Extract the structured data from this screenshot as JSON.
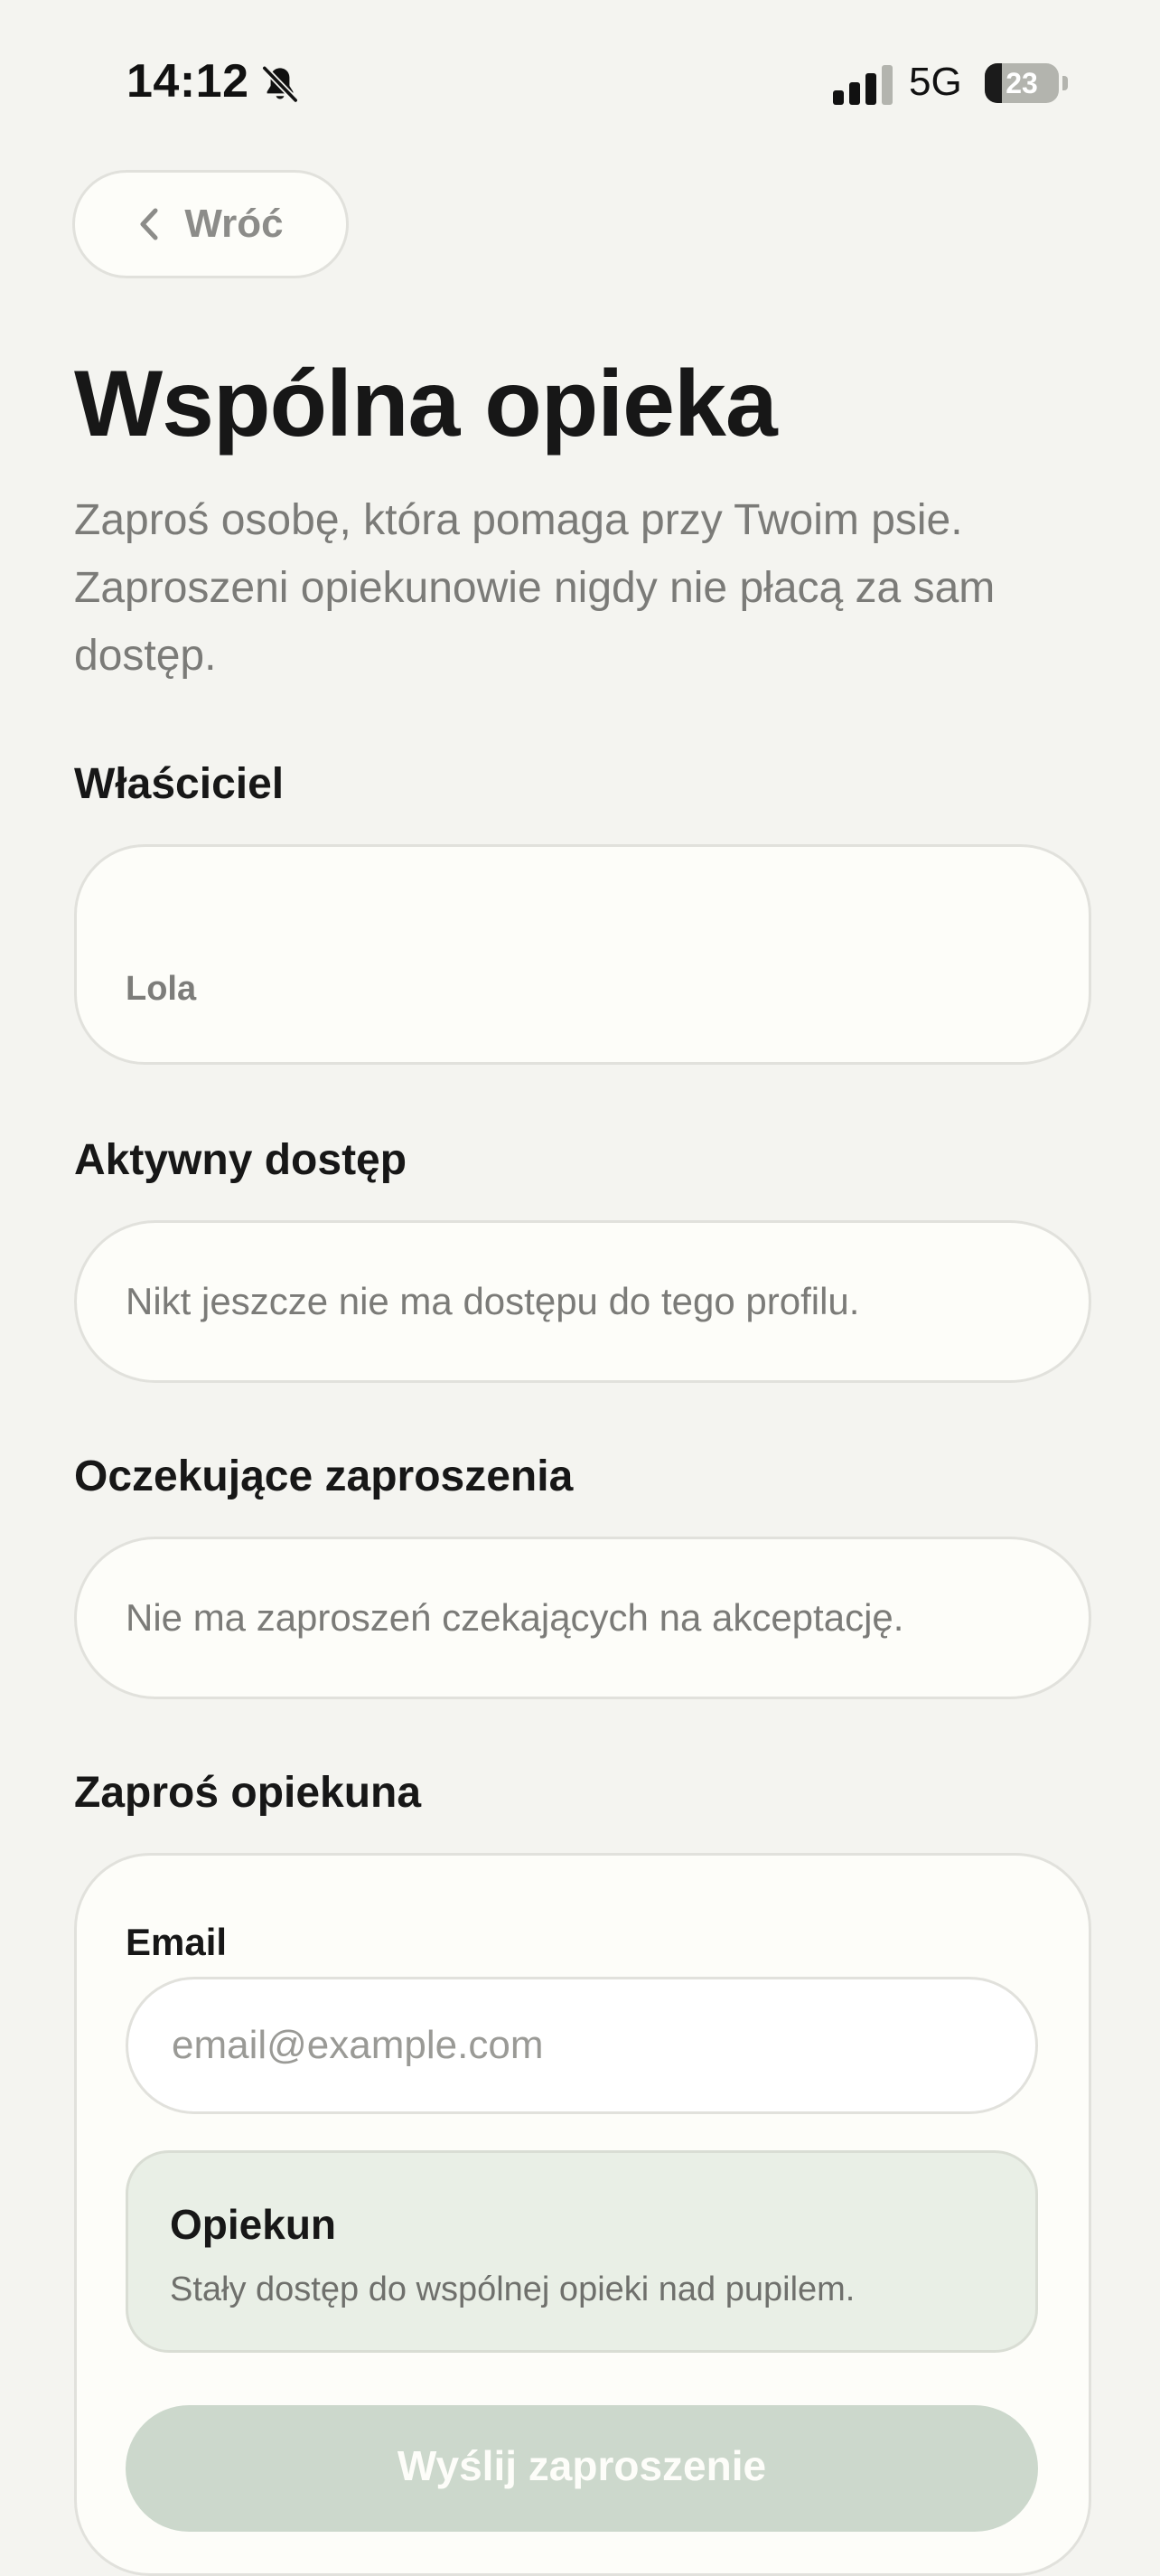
{
  "status_bar": {
    "time": "14:12",
    "network": "5G",
    "battery_percent": 23,
    "battery_text": "23"
  },
  "icons": {
    "bell_off": "bell-off-icon",
    "signal": "signal-icon",
    "back": "chevron-left-icon"
  },
  "header": {
    "back_label": "Wróć",
    "title": "Wspólna opieka",
    "subtitle": "Zaproś osobę, która pomaga przy Twoim psie. Zaproszeni opiekunowie nigdy nie płacą za sam dostęp."
  },
  "owner": {
    "heading": "Właściciel",
    "name": "Lola"
  },
  "active_access": {
    "heading": "Aktywny dostęp",
    "empty_message": "Nikt jeszcze nie ma dostępu do tego profilu."
  },
  "pending_invites": {
    "heading": "Oczekujące zaproszenia",
    "empty_message": "Nie ma zaproszeń czekających na akceptację."
  },
  "invite": {
    "heading": "Zaproś opiekuna",
    "email_label": "Email",
    "email_value": "",
    "email_placeholder": "email@example.com",
    "role_title": "Opiekun",
    "role_description": "Stały dostęp do wspólnej opieki nad pupilem.",
    "submit_label": "Wyślij zaproszenie"
  },
  "colors": {
    "background": "#f4f4f0",
    "card": "#fdfdf9",
    "card_border": "#e1e1dc",
    "selected_role_bg": "#e9efe6",
    "button_disabled": "#ccd8cc",
    "text_primary": "#171717",
    "text_secondary": "#7b7b78"
  }
}
